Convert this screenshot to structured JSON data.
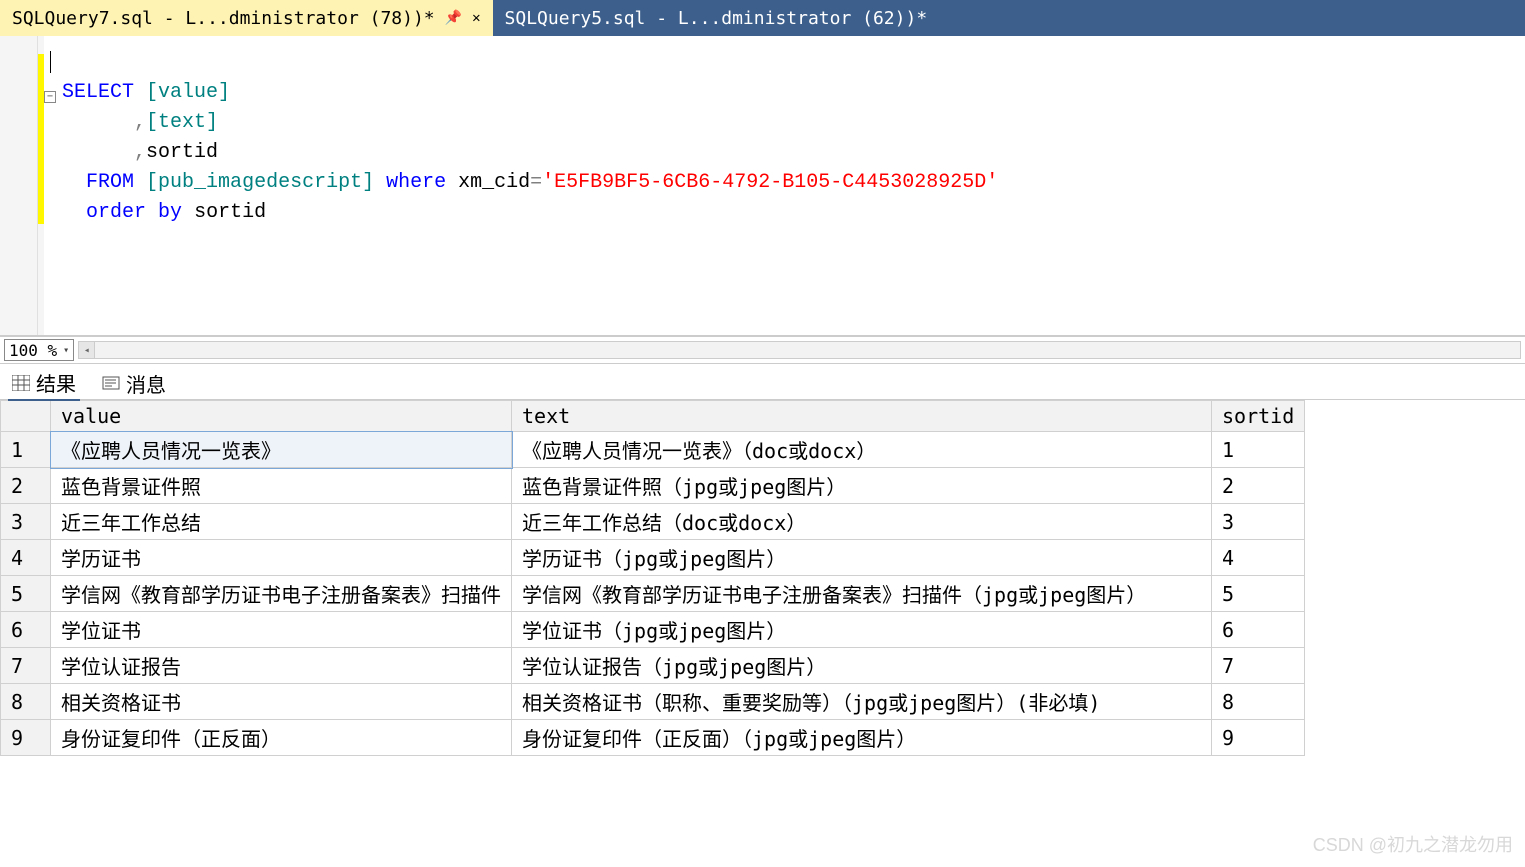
{
  "tabs": [
    {
      "label": "SQLQuery7.sql - L...dministrator (78))*",
      "active": true
    },
    {
      "label": "SQLQuery5.sql - L...dministrator (62))*",
      "active": false
    }
  ],
  "code": {
    "t_select": "SELECT",
    "t_value": "[value]",
    "t_comma1": ",",
    "t_text": "[text]",
    "t_comma2": ",",
    "t_sortid": "sortid",
    "t_from": "FROM",
    "t_table": "[pub_imagedescript]",
    "t_where": "where",
    "t_col": "xm_cid",
    "t_eq": "=",
    "t_str": "'E5FB9BF5-6CB6-4792-B105-C4453028925D'",
    "t_order": "order",
    "t_by": "by",
    "t_sortid2": "sortid"
  },
  "zoom": {
    "value": "100 %"
  },
  "resultTabs": {
    "results": "结果",
    "messages": "消息"
  },
  "grid": {
    "headers": [
      "value",
      "text",
      "sortid"
    ],
    "rows": [
      {
        "n": "1",
        "value": "《应聘人员情况一览表》",
        "text": "《应聘人员情况一览表》（doc或docx）",
        "sortid": "1"
      },
      {
        "n": "2",
        "value": "蓝色背景证件照",
        "text": "蓝色背景证件照（jpg或jpeg图片）",
        "sortid": "2"
      },
      {
        "n": "3",
        "value": "近三年工作总结",
        "text": "近三年工作总结（doc或docx）",
        "sortid": "3"
      },
      {
        "n": "4",
        "value": "学历证书",
        "text": "学历证书（jpg或jpeg图片）",
        "sortid": "4"
      },
      {
        "n": "5",
        "value": "学信网《教育部学历证书电子注册备案表》扫描件",
        "text": "学信网《教育部学历证书电子注册备案表》扫描件（jpg或jpeg图片）",
        "sortid": "5"
      },
      {
        "n": "6",
        "value": "学位证书",
        "text": "学位证书（jpg或jpeg图片）",
        "sortid": "6"
      },
      {
        "n": "7",
        "value": "学位认证报告",
        "text": "学位认证报告（jpg或jpeg图片）",
        "sortid": "7"
      },
      {
        "n": "8",
        "value": "相关资格证书",
        "text": "相关资格证书（职称、重要奖励等）（jpg或jpeg图片）(非必填)",
        "sortid": "8"
      },
      {
        "n": "9",
        "value": "身份证复印件（正反面）",
        "text": "身份证复印件（正反面）（jpg或jpeg图片）",
        "sortid": "9"
      }
    ]
  },
  "watermark": "CSDN @初九之潜龙勿用"
}
